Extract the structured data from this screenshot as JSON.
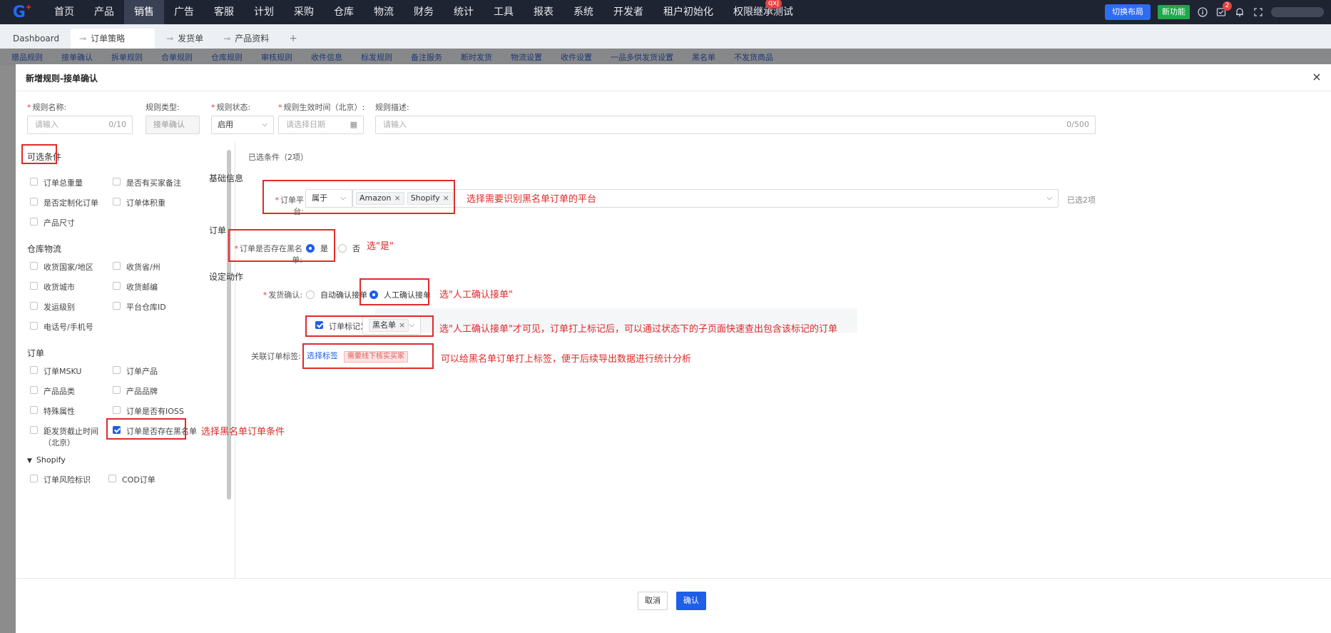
{
  "nav": {
    "items": [
      "首页",
      "产品",
      "销售",
      "广告",
      "客服",
      "计划",
      "采购",
      "仓库",
      "物流",
      "财务",
      "统计",
      "工具",
      "报表",
      "系统",
      "开发者",
      "租户初始化",
      "权限继承测试"
    ],
    "badge": "qxj",
    "switch_layout": "切换布局",
    "new_feature": "新功能",
    "task_badge": "2"
  },
  "tabs": [
    "Dashboard",
    "订单策略",
    "发货单",
    "产品资料",
    "+"
  ],
  "subtabs": [
    "赠品规则",
    "接单确认",
    "拆单规则",
    "合单规则",
    "仓库规则",
    "审核规则",
    "收件信息",
    "标发规则",
    "备注服务",
    "断时发货",
    "物流设置",
    "收件设置",
    "一品多供发货设置",
    "黑名单",
    "不发货商品"
  ],
  "modal": {
    "title": "新增规则-接单确认",
    "close": "×",
    "fields": {
      "name_label": "规则名称:",
      "name_placeholder": "请输入",
      "name_count": "0/10",
      "type_label": "规则类型:",
      "type_value": "接单确认",
      "status_label": "规则状态:",
      "status_value": "启用",
      "time_label": "规则生效时间（北京）:",
      "time_placeholder": "请选择日期",
      "desc_label": "规则描述:",
      "desc_placeholder": "请输入",
      "desc_count": "0/500"
    },
    "left": {
      "title": "可选条件",
      "items_top": [
        "订单总重量",
        "是否有买家备注",
        "是否定制化订单",
        "订单体积重",
        "产品尺寸"
      ],
      "warehouse_title": "仓库物流",
      "warehouse_items": [
        "收货国家/地区",
        "收货省/州",
        "收货城市",
        "收货邮编",
        "发运级别",
        "平台仓库ID",
        "电话号/手机号"
      ],
      "order_title": "订单",
      "order_items": [
        "订单MSKU",
        "订单产品",
        "产品品类",
        "产品品牌",
        "特殊属性",
        "订单是否有IOSS",
        "距发货截止时间（北京）",
        "订单是否存在黑名单"
      ],
      "shopify_title": "Shopify",
      "shopify_items": [
        "订单风险标识",
        "COD订单"
      ]
    },
    "right": {
      "selected_count": "已选条件（2项）",
      "basic_title": "基础信息",
      "platform_label": "订单平台:",
      "platform_op": "属于",
      "platform_tags": [
        "Amazon",
        "Shopify"
      ],
      "platform_selected": "已选2项",
      "order_title": "订单",
      "blacklist_label": "订单是否存在黑名单:",
      "yes": "是",
      "no": "否",
      "action_title": "设定动作",
      "ship_label": "发货确认:",
      "auto_confirm": "自动确认接单",
      "manual_confirm": "人工确认接单",
      "mark_label": "订单标记为",
      "mark_value": "黑名单",
      "tag_label": "关联订单标签:",
      "choose_tag": "选择标签",
      "tag_value": "需要线下核实买家"
    },
    "annotations": {
      "a1": "选择需要识别黑名单订单的平台",
      "a2": "选\"是\"",
      "a3": "选\"人工确认接单\"",
      "a4": "选\"人工确认接单\"才可见，订单打上标记后，可以通过状态下的子页面快速查出包含该标记的订单",
      "a5": "可以给黑名单订单打上标签，便于后续导出数据进行统计分析",
      "a6": "选择黑名单订单条件"
    },
    "footer": {
      "cancel": "取消",
      "confirm": "确认"
    }
  },
  "colors": {
    "nav_bg": "#1f2433",
    "primary": "#1f5ee8",
    "annotation_red": "#e02a2a",
    "new_feature_green": "#1fa94a"
  }
}
